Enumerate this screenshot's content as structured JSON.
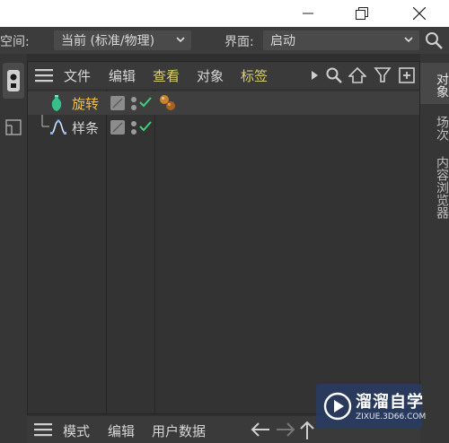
{
  "colors": {
    "accent_yellow": "#f0c040",
    "menu_highlight": "#d8d070",
    "check_green": "#3fd07a",
    "object_green": "#36c08a",
    "panel_bg": "#333333"
  },
  "topbar": {
    "space_label": "空间:",
    "space_value": "当前 (标准/物理)",
    "layout_label": "界面:",
    "layout_value": "启动"
  },
  "menubar": {
    "items": [
      "文件",
      "编辑",
      "查看",
      "对象",
      "标签"
    ]
  },
  "objects": [
    {
      "name": "旋转",
      "icon": "lathe-object-icon",
      "selected": true,
      "has_tags": true
    },
    {
      "name": "样条",
      "icon": "spline-icon",
      "selected": false,
      "has_tags": false
    }
  ],
  "right_tabs": [
    "对象",
    "场次",
    "内容浏览器"
  ],
  "bottombar": {
    "items": [
      "模式",
      "编辑",
      "用户数据"
    ]
  },
  "watermark": {
    "title": "溜溜自学",
    "url": "ZIXUE.3D66.COM"
  }
}
